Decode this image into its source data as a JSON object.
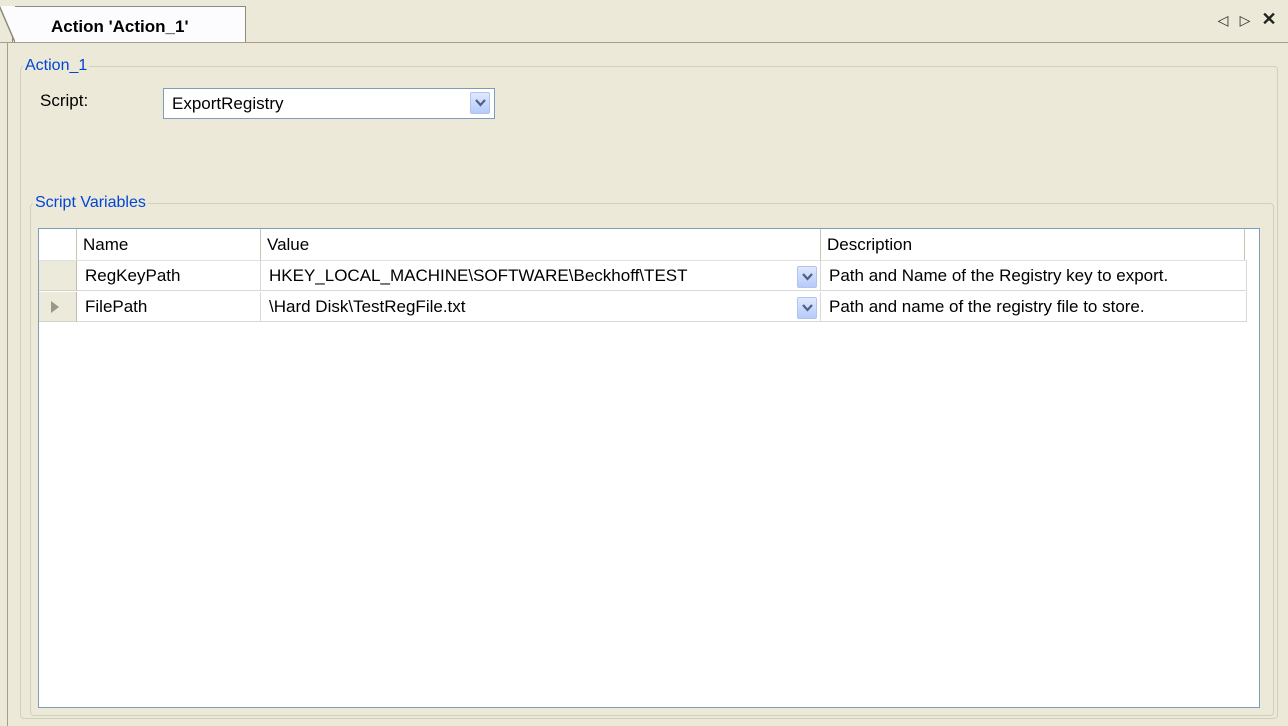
{
  "tab": {
    "label": "Action 'Action_1'"
  },
  "tab_controls": {
    "left_icon": "scroll-left-icon",
    "right_icon": "scroll-right-icon",
    "close_icon": "close-icon"
  },
  "action_group": {
    "legend": "Action_1",
    "script_label": "Script:",
    "script_value": "ExportRegistry"
  },
  "variables_group": {
    "legend": "Script Variables"
  },
  "grid": {
    "columns": [
      "Name",
      "Value",
      "Description"
    ],
    "rows": [
      {
        "name": "RegKeyPath",
        "value": "HKEY_LOCAL_MACHINE\\SOFTWARE\\Beckhoff\\TEST",
        "description": "Path and Name of the Registry key to export."
      },
      {
        "name": "FilePath",
        "value": "\\Hard Disk\\TestRegFile.txt",
        "description": "Path and name of the registry file to store."
      }
    ]
  },
  "colors": {
    "legend": "#0046d5",
    "background": "#ece9d8",
    "combo_border": "#7f9db9"
  }
}
